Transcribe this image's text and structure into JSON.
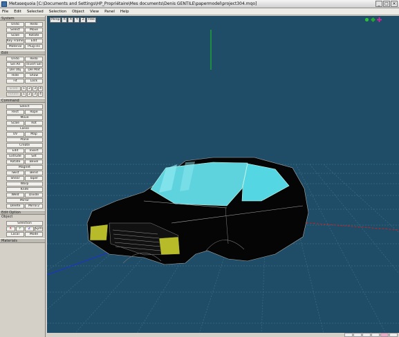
{
  "window": {
    "title": "Metasequoia [C:\\Documents and Settings\\HP_Propriétaire\\Mes documents\\Denis GENTILE\\papermodel\\project304.mqo]",
    "controls": [
      "_",
      "□",
      "×"
    ]
  },
  "menu": [
    "File",
    "Edit",
    "Selected",
    "Selection",
    "Object",
    "View",
    "Panel",
    "Help"
  ],
  "sidebar": {
    "system_head": "System",
    "system_rows": [
      [
        "Undo",
        "Redo"
      ],
      [
        "Select",
        "Move"
      ],
      [
        "Scale",
        "Rotate"
      ],
      [
        "Key Frame ANM",
        "Edit"
      ],
      [
        "Material",
        "Plug-ins"
      ]
    ],
    "edit_head": "Edit",
    "edit_rows": [
      [
        "Undo",
        "Redo"
      ],
      [
        "Sel All",
        "Invert Sel"
      ],
      [
        "Del Obj",
        "Del Mat"
      ],
      [
        "Hide",
        "Show"
      ],
      [
        "Fit",
        "Lock"
      ]
    ],
    "scale_label": "Scale",
    "scale_nums": [
      "1",
      "2",
      "3",
      "4"
    ],
    "rotate_label": "Rotate",
    "rotate_nums": [
      "1",
      "2",
      "3",
      "4"
    ],
    "command_head": "Command",
    "command_rows": [
      [
        "Select"
      ],
      [
        "Rect",
        "Rope"
      ],
      [
        "Move"
      ],
      [
        "Scale",
        "Rot"
      ],
      [
        "Lasso"
      ],
      [
        "UV",
        "Map"
      ],
      [
        "Plane"
      ],
      [
        "Create"
      ],
      [
        "Edit",
        "Insert"
      ],
      [
        "Extrude",
        "Set"
      ],
      [
        "Rotate",
        "Bevel"
      ],
      [
        "Magnet"
      ],
      [
        "Twist",
        "Bend"
      ],
      [
        "Shear",
        "Taper"
      ],
      [
        "Warp"
      ],
      [
        "Knife"
      ],
      [
        "Weld",
        "Divide"
      ],
      [
        "Mirror"
      ],
      [
        "Delete",
        "Mirror2"
      ]
    ],
    "editoption_head": "Edit Option",
    "editoption_sub": "Object",
    "editoption_rows": [
      [
        "Selection"
      ],
      [
        "X",
        "Y",
        "Z",
        "Sym"
      ],
      [
        "Local",
        "Mode"
      ]
    ],
    "misc_head": "Materials"
  },
  "viewport": {
    "toolbar": [
      "Persp",
      "R",
      "X",
      "Y",
      "Z",
      "Free"
    ],
    "bg_color": "#1f4c66",
    "grid_color": "#3b6e86",
    "axis_green": "#1ecb1e",
    "axis_red": "#d02020",
    "axis_blue": "#2030d0"
  },
  "statusbar": {
    "cells": [
      "",
      "",
      "",
      "",
      "",
      ""
    ]
  }
}
